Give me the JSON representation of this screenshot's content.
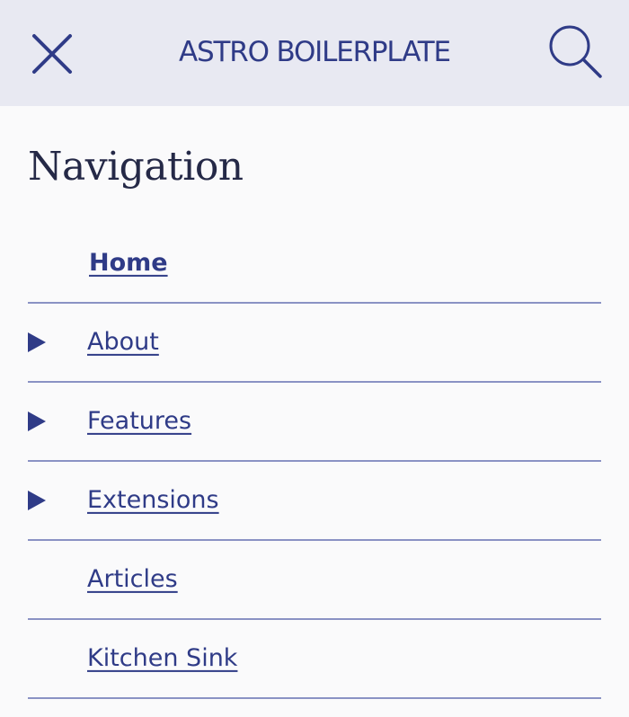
{
  "header": {
    "title": "ASTRO BOILERPLATE",
    "close_icon": "close-icon",
    "search_icon": "search-icon"
  },
  "nav": {
    "heading": "Navigation",
    "items": [
      {
        "label": "Home",
        "active": true,
        "expandable": false
      },
      {
        "label": "About",
        "active": false,
        "expandable": true
      },
      {
        "label": "Features",
        "active": false,
        "expandable": true
      },
      {
        "label": "Extensions",
        "active": false,
        "expandable": true
      },
      {
        "label": "Articles",
        "active": false,
        "expandable": false
      },
      {
        "label": "Kitchen Sink",
        "active": false,
        "expandable": false
      }
    ]
  },
  "colors": {
    "accent": "#2f3b87",
    "header_bg": "#e8e9f2",
    "page_bg": "#fafafb",
    "divider": "#8a92c4",
    "heading_text": "#252947"
  }
}
